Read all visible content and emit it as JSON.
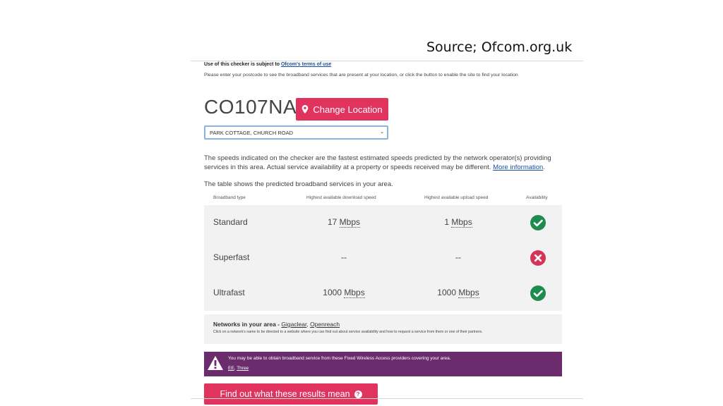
{
  "source": "Source; Ofcom.org.uk",
  "terms": {
    "prefix": "Use of this checker is subject to",
    "link": "Ofcom's terms of use"
  },
  "instructions": "Please enter your postcode to see the broadband services that are present at your location, or click the button to enable the site to find your location",
  "postcode": "CO107NA",
  "change_location_label": "Change Location",
  "address_select": {
    "selected": "PARK COTTAGE, CHURCH ROAD"
  },
  "disclaimer": {
    "text": "The speeds indicated on the checker are the fastest estimated speeds predicted by the network operator(s) providing services in this area. Actual service availability at a property or speeds received may be different.",
    "link": "More information",
    "end": "."
  },
  "table_intro": "The table shows the predicted broadband services in your area.",
  "table": {
    "headers": [
      "Broadband type",
      "Highest available download speed",
      "Highest available upload speed",
      "Availability"
    ],
    "rows": [
      {
        "type": "Standard",
        "download_value": "17",
        "download_unit": "Mbps",
        "upload_value": "1",
        "upload_unit": "Mbps",
        "available": true
      },
      {
        "type": "Superfast",
        "download_value": "--",
        "download_unit": "",
        "upload_value": "--",
        "upload_unit": "",
        "available": false
      },
      {
        "type": "Ultrafast",
        "download_value": "1000",
        "download_unit": "Mbps",
        "upload_value": "1000",
        "upload_unit": "Mbps",
        "available": true
      }
    ]
  },
  "networks": {
    "title": "Networks in your area -",
    "links": [
      "Gigaclear",
      "Openreach"
    ],
    "separator": ",",
    "note": "Click on a network's name to be directed to a website where you can find out about service availability and how to request a service from them or one of their partners."
  },
  "fwa": {
    "message": "You may be able to obtain broadband service from these Fixed Wireless Access providers covering your area.",
    "providers": [
      "EE",
      "Three"
    ],
    "separator": ","
  },
  "find_out_label": "Find out what these results mean",
  "colors": {
    "accent": "#e0335e",
    "available": "#1e8c4e",
    "unavailable": "#d63357",
    "banner": "#6a2c6d",
    "link": "#1a4fa3"
  },
  "icons": {
    "pin": "map-marker-icon",
    "available": "check-circle-icon",
    "unavailable": "x-circle-icon",
    "warning": "warning-triangle-icon",
    "help": "question-circle-icon"
  }
}
